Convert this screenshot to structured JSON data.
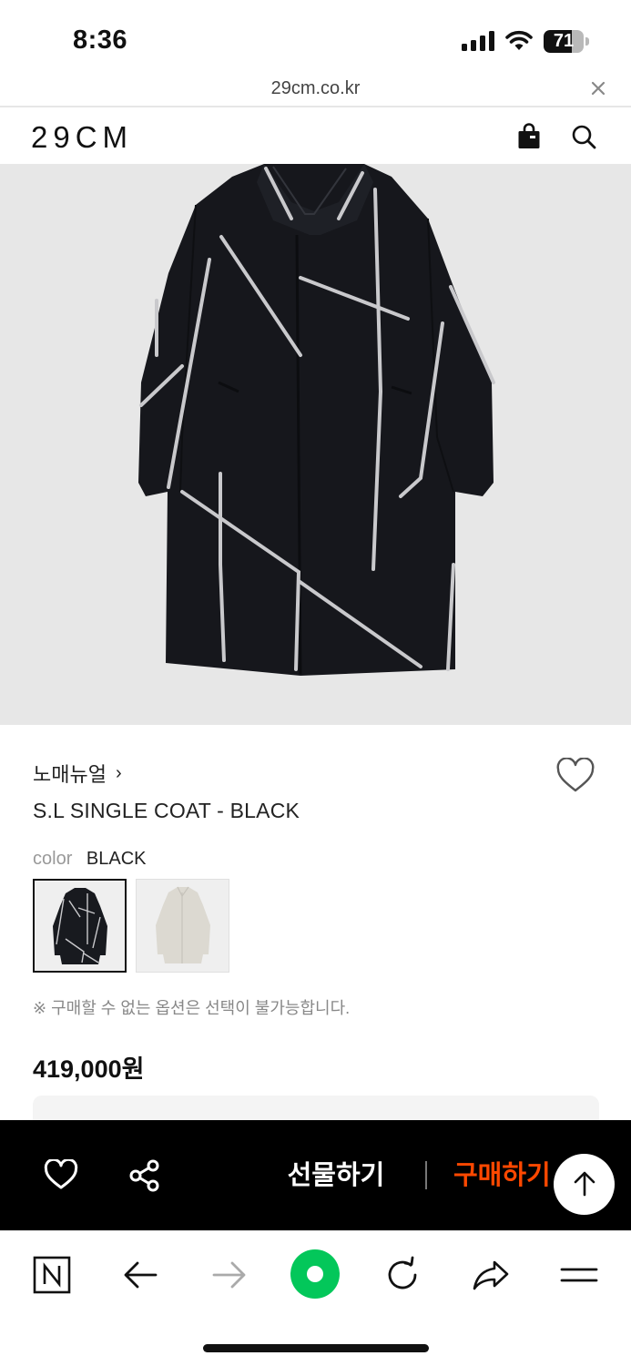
{
  "status_bar": {
    "time": "8:36",
    "battery": "71",
    "battery_level_percent": 71
  },
  "browser": {
    "url": "29cm.co.kr"
  },
  "site": {
    "logo": "29CM"
  },
  "product": {
    "brand": "노매뉴얼",
    "brand_chevron": "›",
    "name": "S.L SINGLE COAT - BLACK",
    "color_label": "color",
    "color_value": "BLACK",
    "notice": "※ 구매할 수 없는 옵션은 선택이 불가능합니다.",
    "price": "419,000원"
  },
  "purchase_bar": {
    "gift_label": "선물하기",
    "buy_label": "구매하기"
  },
  "colors": {
    "accent": "#ff4800",
    "naver_green": "#03c75a",
    "bar_background": "#000000",
    "image_background": "#e7e7e7"
  },
  "icons": {
    "wish": "heart-outline-icon",
    "share": "share-nodes-icon",
    "bag": "shopping-bag-icon",
    "search": "search-icon",
    "scroll_top": "arrow-up-icon",
    "toolbar": [
      "naver-n-icon",
      "back-arrow-icon",
      "forward-arrow-icon",
      "naver-green-circle-icon",
      "reload-icon",
      "share-arrow-icon",
      "menu-icon"
    ]
  }
}
